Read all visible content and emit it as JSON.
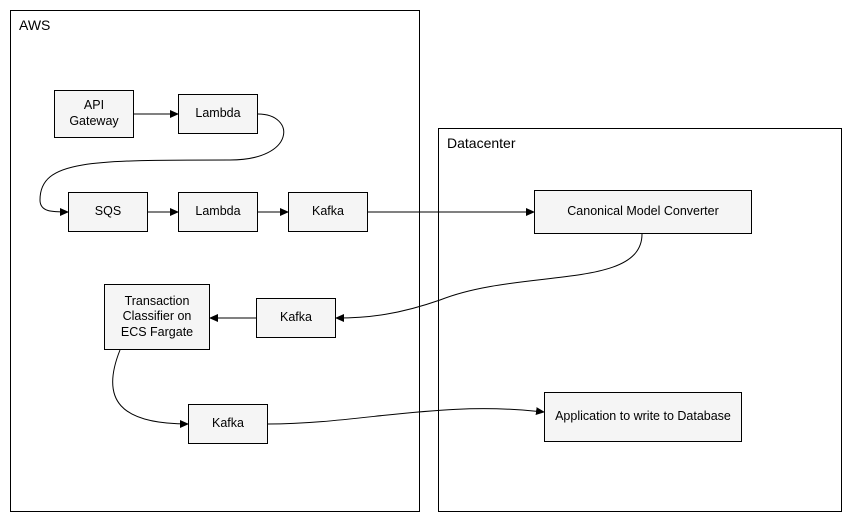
{
  "containers": {
    "aws": {
      "label": "AWS"
    },
    "datacenter": {
      "label": "Datacenter"
    }
  },
  "nodes": {
    "api_gateway": {
      "label": "API Gateway"
    },
    "lambda1": {
      "label": "Lambda"
    },
    "sqs": {
      "label": "SQS"
    },
    "lambda2": {
      "label": "Lambda"
    },
    "kafka1": {
      "label": "Kafka"
    },
    "canonical": {
      "label": "Canonical Model Converter"
    },
    "kafka2": {
      "label": "Kafka"
    },
    "classifier": {
      "label": "Transaction Classifier on ECS Fargate"
    },
    "kafka3": {
      "label": "Kafka"
    },
    "db_writer": {
      "label": "Application to write to Database"
    }
  },
  "edges": [
    {
      "from": "api_gateway",
      "to": "lambda1"
    },
    {
      "from": "lambda1",
      "to": "sqs"
    },
    {
      "from": "sqs",
      "to": "lambda2"
    },
    {
      "from": "lambda2",
      "to": "kafka1"
    },
    {
      "from": "kafka1",
      "to": "canonical"
    },
    {
      "from": "canonical",
      "to": "kafka2"
    },
    {
      "from": "kafka2",
      "to": "classifier"
    },
    {
      "from": "classifier",
      "to": "kafka3"
    },
    {
      "from": "kafka3",
      "to": "db_writer"
    }
  ]
}
